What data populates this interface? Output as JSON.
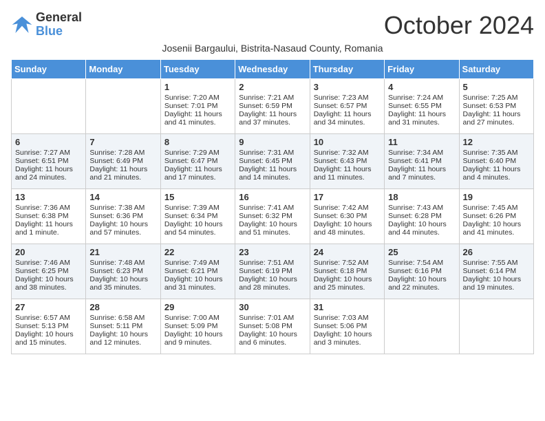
{
  "logo": {
    "line1": "General",
    "line2": "Blue"
  },
  "title": "October 2024",
  "subtitle": "Josenii Bargaului, Bistrita-Nasaud County, Romania",
  "days_of_week": [
    "Sunday",
    "Monday",
    "Tuesday",
    "Wednesday",
    "Thursday",
    "Friday",
    "Saturday"
  ],
  "weeks": [
    [
      {
        "day": "",
        "content": ""
      },
      {
        "day": "",
        "content": ""
      },
      {
        "day": "1",
        "content": "Sunrise: 7:20 AM\nSunset: 7:01 PM\nDaylight: 11 hours and 41 minutes."
      },
      {
        "day": "2",
        "content": "Sunrise: 7:21 AM\nSunset: 6:59 PM\nDaylight: 11 hours and 37 minutes."
      },
      {
        "day": "3",
        "content": "Sunrise: 7:23 AM\nSunset: 6:57 PM\nDaylight: 11 hours and 34 minutes."
      },
      {
        "day": "4",
        "content": "Sunrise: 7:24 AM\nSunset: 6:55 PM\nDaylight: 11 hours and 31 minutes."
      },
      {
        "day": "5",
        "content": "Sunrise: 7:25 AM\nSunset: 6:53 PM\nDaylight: 11 hours and 27 minutes."
      }
    ],
    [
      {
        "day": "6",
        "content": "Sunrise: 7:27 AM\nSunset: 6:51 PM\nDaylight: 11 hours and 24 minutes."
      },
      {
        "day": "7",
        "content": "Sunrise: 7:28 AM\nSunset: 6:49 PM\nDaylight: 11 hours and 21 minutes."
      },
      {
        "day": "8",
        "content": "Sunrise: 7:29 AM\nSunset: 6:47 PM\nDaylight: 11 hours and 17 minutes."
      },
      {
        "day": "9",
        "content": "Sunrise: 7:31 AM\nSunset: 6:45 PM\nDaylight: 11 hours and 14 minutes."
      },
      {
        "day": "10",
        "content": "Sunrise: 7:32 AM\nSunset: 6:43 PM\nDaylight: 11 hours and 11 minutes."
      },
      {
        "day": "11",
        "content": "Sunrise: 7:34 AM\nSunset: 6:41 PM\nDaylight: 11 hours and 7 minutes."
      },
      {
        "day": "12",
        "content": "Sunrise: 7:35 AM\nSunset: 6:40 PM\nDaylight: 11 hours and 4 minutes."
      }
    ],
    [
      {
        "day": "13",
        "content": "Sunrise: 7:36 AM\nSunset: 6:38 PM\nDaylight: 11 hours and 1 minute."
      },
      {
        "day": "14",
        "content": "Sunrise: 7:38 AM\nSunset: 6:36 PM\nDaylight: 10 hours and 57 minutes."
      },
      {
        "day": "15",
        "content": "Sunrise: 7:39 AM\nSunset: 6:34 PM\nDaylight: 10 hours and 54 minutes."
      },
      {
        "day": "16",
        "content": "Sunrise: 7:41 AM\nSunset: 6:32 PM\nDaylight: 10 hours and 51 minutes."
      },
      {
        "day": "17",
        "content": "Sunrise: 7:42 AM\nSunset: 6:30 PM\nDaylight: 10 hours and 48 minutes."
      },
      {
        "day": "18",
        "content": "Sunrise: 7:43 AM\nSunset: 6:28 PM\nDaylight: 10 hours and 44 minutes."
      },
      {
        "day": "19",
        "content": "Sunrise: 7:45 AM\nSunset: 6:26 PM\nDaylight: 10 hours and 41 minutes."
      }
    ],
    [
      {
        "day": "20",
        "content": "Sunrise: 7:46 AM\nSunset: 6:25 PM\nDaylight: 10 hours and 38 minutes."
      },
      {
        "day": "21",
        "content": "Sunrise: 7:48 AM\nSunset: 6:23 PM\nDaylight: 10 hours and 35 minutes."
      },
      {
        "day": "22",
        "content": "Sunrise: 7:49 AM\nSunset: 6:21 PM\nDaylight: 10 hours and 31 minutes."
      },
      {
        "day": "23",
        "content": "Sunrise: 7:51 AM\nSunset: 6:19 PM\nDaylight: 10 hours and 28 minutes."
      },
      {
        "day": "24",
        "content": "Sunrise: 7:52 AM\nSunset: 6:18 PM\nDaylight: 10 hours and 25 minutes."
      },
      {
        "day": "25",
        "content": "Sunrise: 7:54 AM\nSunset: 6:16 PM\nDaylight: 10 hours and 22 minutes."
      },
      {
        "day": "26",
        "content": "Sunrise: 7:55 AM\nSunset: 6:14 PM\nDaylight: 10 hours and 19 minutes."
      }
    ],
    [
      {
        "day": "27",
        "content": "Sunrise: 6:57 AM\nSunset: 5:13 PM\nDaylight: 10 hours and 15 minutes."
      },
      {
        "day": "28",
        "content": "Sunrise: 6:58 AM\nSunset: 5:11 PM\nDaylight: 10 hours and 12 minutes."
      },
      {
        "day": "29",
        "content": "Sunrise: 7:00 AM\nSunset: 5:09 PM\nDaylight: 10 hours and 9 minutes."
      },
      {
        "day": "30",
        "content": "Sunrise: 7:01 AM\nSunset: 5:08 PM\nDaylight: 10 hours and 6 minutes."
      },
      {
        "day": "31",
        "content": "Sunrise: 7:03 AM\nSunset: 5:06 PM\nDaylight: 10 hours and 3 minutes."
      },
      {
        "day": "",
        "content": ""
      },
      {
        "day": "",
        "content": ""
      }
    ]
  ]
}
